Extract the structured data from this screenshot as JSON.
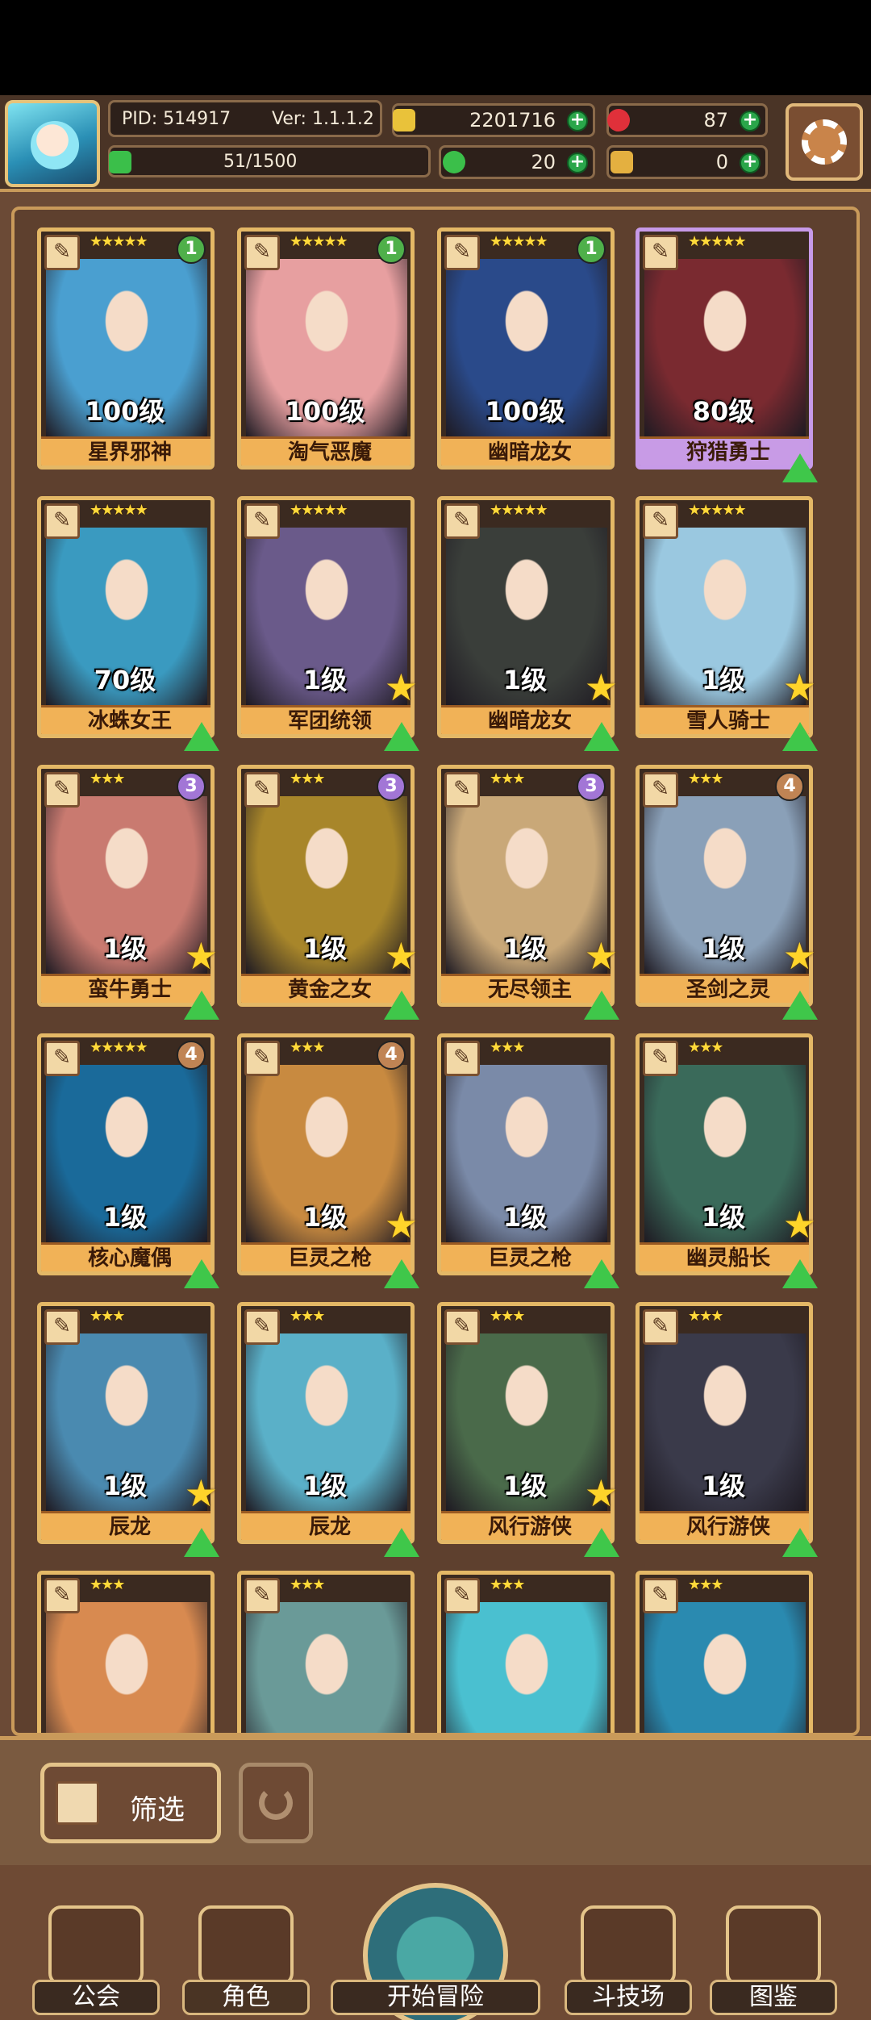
{
  "player": {
    "pid_label": "PID: 514917",
    "version_label": "Ver: 1.1.1.2",
    "exp": "51/1500",
    "gold": "2201716",
    "gems": "87",
    "clover": "20",
    "keys": "0"
  },
  "colors": {
    "plus": "#2aa64a",
    "card_border_gold": "#e4b866",
    "card_border_purple": "#c79ae8",
    "name_bar": "#f1b257"
  },
  "heroes": [
    {
      "name": "星界邪神",
      "level": "100级",
      "stars": "★★★★★",
      "badge": "1",
      "frame": "gold",
      "star_icon": false,
      "upgrade": false,
      "art": "#4a9fd0"
    },
    {
      "name": "淘气恶魔",
      "level": "100级",
      "stars": "★★★★★",
      "badge": "1",
      "frame": "gold",
      "star_icon": false,
      "upgrade": false,
      "art": "#e79fa0"
    },
    {
      "name": "幽暗龙女",
      "level": "100级",
      "stars": "★★★★★",
      "badge": "1",
      "frame": "gold",
      "star_icon": false,
      "upgrade": false,
      "art": "#2a4a8a"
    },
    {
      "name": "狩猎勇士",
      "level": "80级",
      "stars": "★★★★★",
      "badge": "",
      "frame": "purple",
      "star_icon": false,
      "upgrade": true,
      "art": "#7a2a30"
    },
    {
      "name": "冰蛛女王",
      "level": "70级",
      "stars": "★★★★★",
      "badge": "",
      "frame": "gold",
      "star_icon": false,
      "upgrade": true,
      "art": "#3a9ac0"
    },
    {
      "name": "军团统领",
      "level": "1级",
      "stars": "★★★★★",
      "badge": "",
      "frame": "gold",
      "star_icon": true,
      "upgrade": true,
      "art": "#6a5a8a"
    },
    {
      "name": "幽暗龙女",
      "level": "1级",
      "stars": "★★★★★",
      "badge": "",
      "frame": "gold",
      "star_icon": true,
      "upgrade": true,
      "art": "#3a3e3a"
    },
    {
      "name": "雪人骑士",
      "level": "1级",
      "stars": "★★★★★",
      "badge": "",
      "frame": "gold",
      "star_icon": true,
      "upgrade": true,
      "art": "#9ac8e0"
    },
    {
      "name": "蛮牛勇士",
      "level": "1级",
      "stars": "★★★",
      "badge": "3",
      "frame": "gold",
      "star_icon": true,
      "upgrade": true,
      "art": "#c97a70"
    },
    {
      "name": "黄金之女",
      "level": "1级",
      "stars": "★★★",
      "badge": "3",
      "frame": "gold",
      "star_icon": true,
      "upgrade": true,
      "art": "#a8862a"
    },
    {
      "name": "无尽领主",
      "level": "1级",
      "stars": "★★★",
      "badge": "3",
      "frame": "gold",
      "star_icon": true,
      "upgrade": true,
      "art": "#c9a878"
    },
    {
      "name": "圣剑之灵",
      "level": "1级",
      "stars": "★★★",
      "badge": "4",
      "frame": "gold",
      "star_icon": true,
      "upgrade": true,
      "art": "#8aa0b8"
    },
    {
      "name": "核心魔偶",
      "level": "1级",
      "stars": "★★★★★",
      "badge": "4",
      "frame": "gold",
      "star_icon": false,
      "upgrade": true,
      "art": "#1a6a9a"
    },
    {
      "name": "巨灵之枪",
      "level": "1级",
      "stars": "★★★",
      "badge": "4",
      "frame": "gold",
      "star_icon": true,
      "upgrade": true,
      "art": "#c88a40"
    },
    {
      "name": "巨灵之枪",
      "level": "1级",
      "stars": "★★★",
      "badge": "",
      "frame": "gold",
      "star_icon": false,
      "upgrade": true,
      "art": "#7a8aa8"
    },
    {
      "name": "幽灵船长",
      "level": "1级",
      "stars": "★★★",
      "badge": "",
      "frame": "gold",
      "star_icon": true,
      "upgrade": true,
      "art": "#3a6a5a"
    },
    {
      "name": "辰龙",
      "level": "1级",
      "stars": "★★★",
      "badge": "",
      "frame": "gold",
      "star_icon": true,
      "upgrade": true,
      "art": "#4a8ab0"
    },
    {
      "name": "辰龙",
      "level": "1级",
      "stars": "★★★",
      "badge": "",
      "frame": "gold",
      "star_icon": false,
      "upgrade": true,
      "art": "#5ab0c8"
    },
    {
      "name": "风行游侠",
      "level": "1级",
      "stars": "★★★",
      "badge": "",
      "frame": "gold",
      "star_icon": true,
      "upgrade": true,
      "art": "#4a6a4a"
    },
    {
      "name": "风行游侠",
      "level": "1级",
      "stars": "★★★",
      "badge": "",
      "frame": "gold",
      "star_icon": false,
      "upgrade": true,
      "art": "#3a3a4a"
    },
    {
      "name": "",
      "level": "",
      "stars": "★★★",
      "badge": "",
      "frame": "gold",
      "star_icon": false,
      "upgrade": false,
      "art": "#d88a50"
    },
    {
      "name": "",
      "level": "",
      "stars": "★★★",
      "badge": "",
      "frame": "gold",
      "star_icon": false,
      "upgrade": false,
      "art": "#6a9a98"
    },
    {
      "name": "",
      "level": "",
      "stars": "★★★",
      "badge": "",
      "frame": "gold",
      "star_icon": false,
      "upgrade": false,
      "art": "#4ac0d0"
    },
    {
      "name": "",
      "level": "",
      "stars": "★★★",
      "badge": "",
      "frame": "gold",
      "star_icon": false,
      "upgrade": false,
      "art": "#2a8ab0"
    }
  ],
  "toolbar": {
    "filter_label": "筛选",
    "filter_icon": "grid-icon",
    "reset_icon": "refresh-icon"
  },
  "nav": {
    "guild": "公会",
    "characters": "角色",
    "adventure": "开始冒险",
    "arena": "斗技场",
    "codex": "图鉴"
  }
}
